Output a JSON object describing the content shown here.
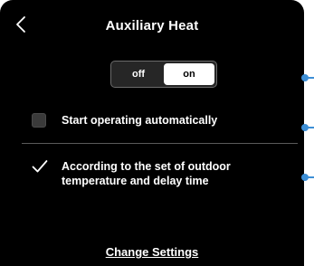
{
  "header": {
    "title": "Auxiliary Heat",
    "back_icon": "chevron-left-icon"
  },
  "toggle": {
    "off_label": "off",
    "on_label": "on",
    "selected": "on"
  },
  "options": [
    {
      "label": "Start operating automatically",
      "checked": false
    },
    {
      "label_line1": "According to the set of outdoor",
      "label_line2": "temperature and delay time",
      "checked": true
    }
  ],
  "footer": {
    "change_settings_label": "Change Settings"
  },
  "colors": {
    "background": "#000000",
    "text": "#ffffff",
    "marker": "#3d8fd6"
  }
}
